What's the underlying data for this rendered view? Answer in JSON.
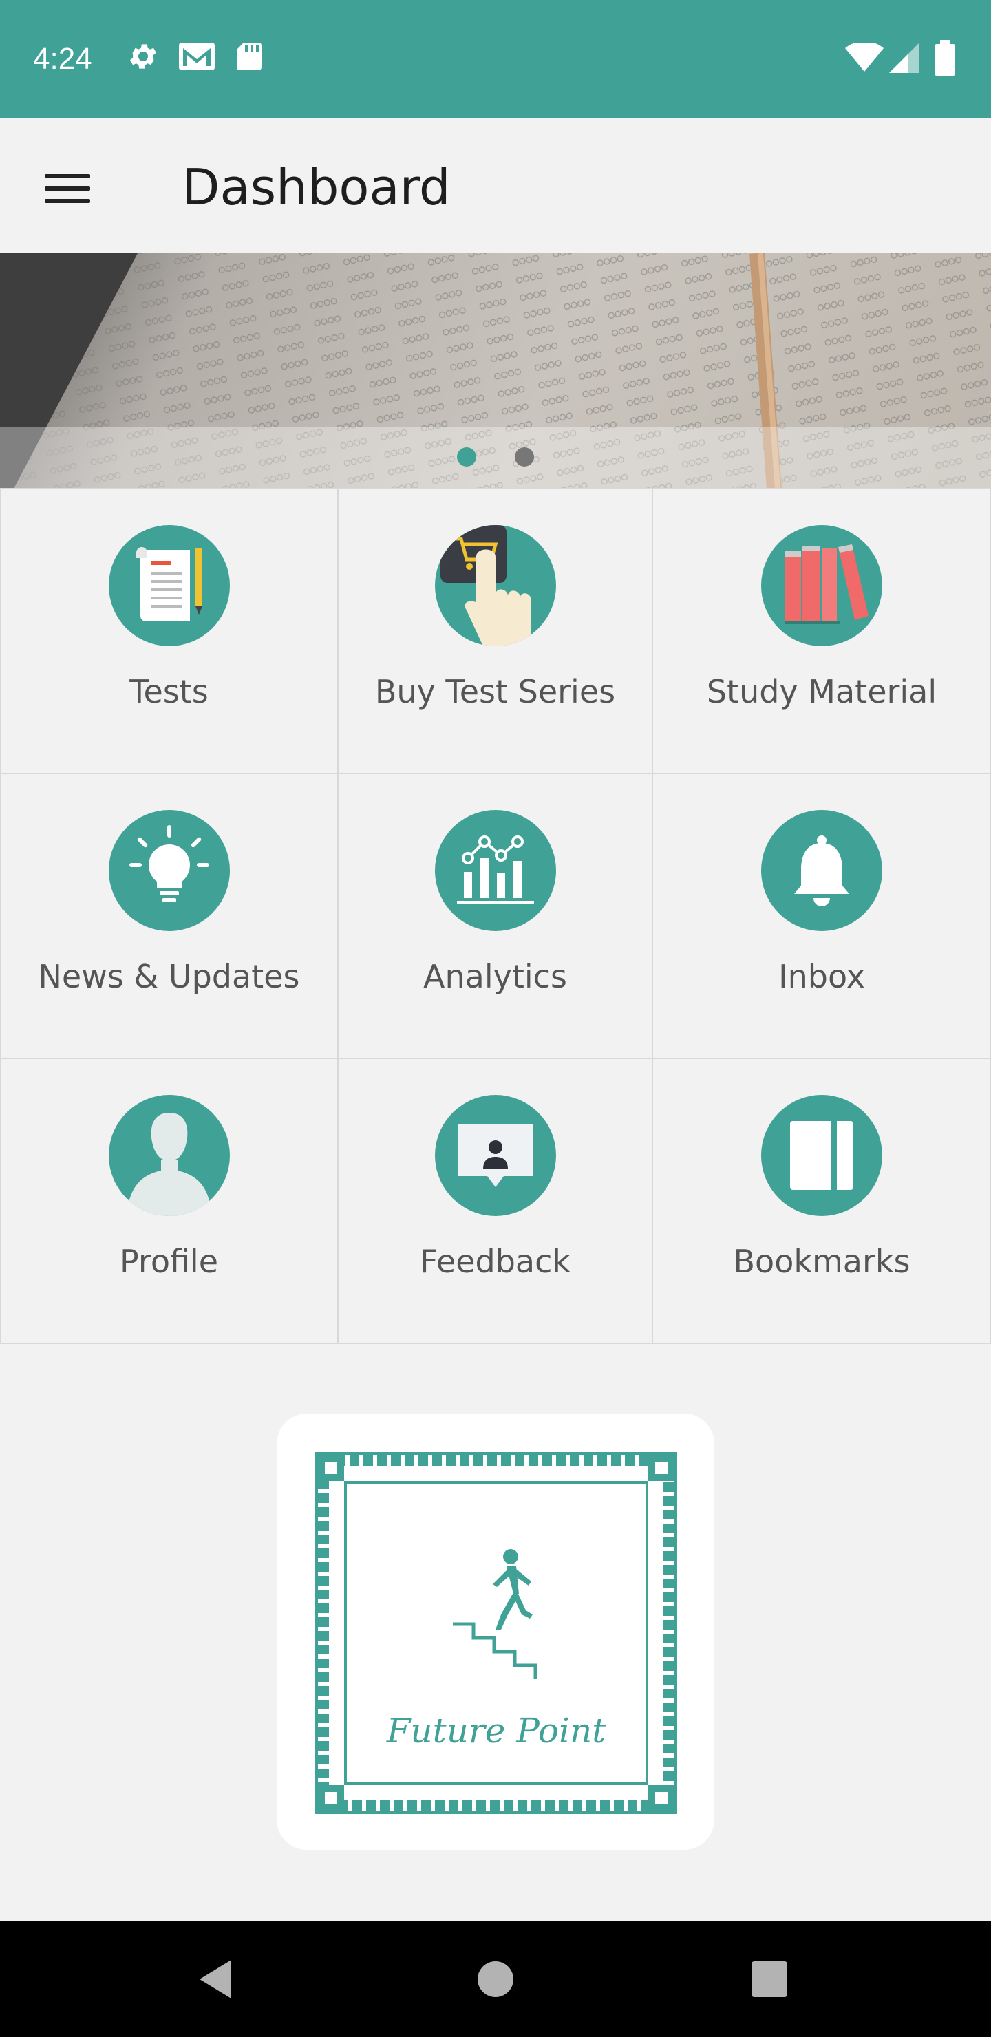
{
  "status_bar": {
    "time": "4:24",
    "icons": [
      "settings-icon",
      "gmail-icon",
      "sd-card-icon",
      "wifi-icon",
      "signal-icon",
      "battery-icon"
    ]
  },
  "app_bar": {
    "title": "Dashboard",
    "menu_icon": "hamburger-menu-icon"
  },
  "banner": {
    "image": "exam-answer-sheet-with-pencil",
    "pages": 2,
    "active_page": 1
  },
  "tiles": [
    {
      "label": "Tests",
      "icon": "test-paper-icon"
    },
    {
      "label": "Buy Test Series",
      "icon": "shopping-cart-icon"
    },
    {
      "label": "Study Material",
      "icon": "books-icon"
    },
    {
      "label": "News & Updates",
      "icon": "lightbulb-icon"
    },
    {
      "label": "Analytics",
      "icon": "analytics-chart-icon"
    },
    {
      "label": "Inbox",
      "icon": "bell-icon"
    },
    {
      "label": "Profile",
      "icon": "user-icon"
    },
    {
      "label": "Feedback",
      "icon": "feedback-icon"
    },
    {
      "label": "Bookmarks",
      "icon": "bookmark-icon"
    }
  ],
  "logo": {
    "text": "Future Point",
    "icon": "man-climbing-stairs-icon"
  },
  "nav_bar": {
    "icons": [
      "back-icon",
      "home-icon",
      "recents-icon"
    ]
  },
  "colors": {
    "primary": "#40a196",
    "background": "#f2f2f2",
    "label": "#555555"
  }
}
